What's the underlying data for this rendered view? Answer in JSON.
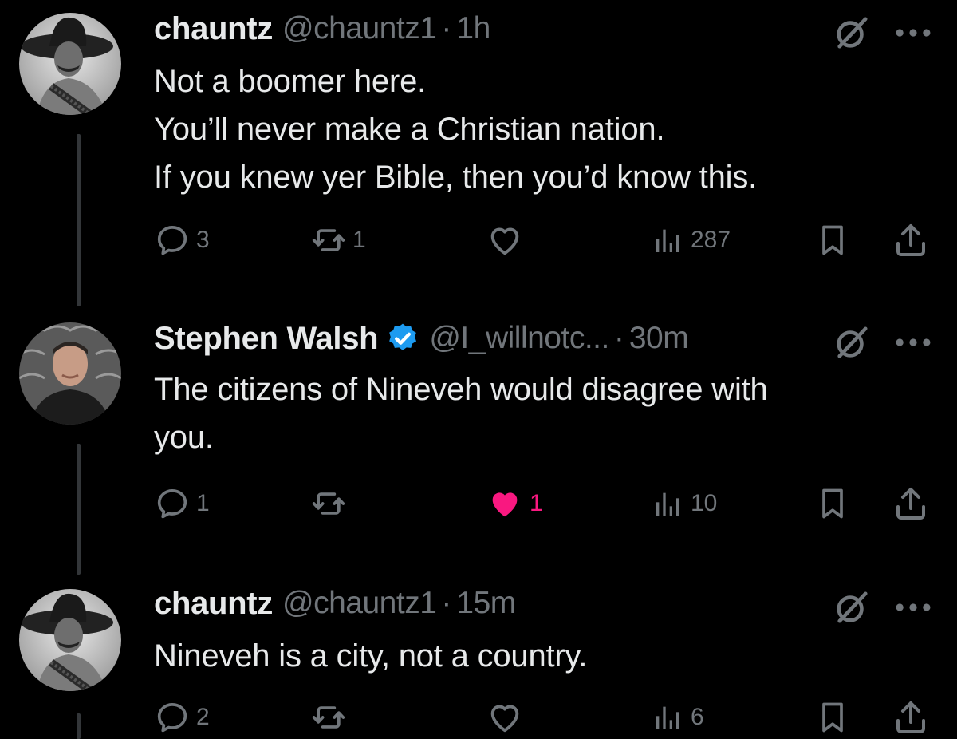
{
  "colors": {
    "background": "#000000",
    "text_primary": "#e7e9ea",
    "text_secondary": "#71767b",
    "like_active": "#f91880",
    "verified": "#1d9bf0"
  },
  "tweets": [
    {
      "display_name": "chauntz",
      "handle": "@chauntz1",
      "separator": "·",
      "time": "1h",
      "verified": false,
      "lines": [
        "Not a boomer here.",
        "You’ll never make a Christian nation.",
        "If you knew yer Bible, then you’d know this."
      ],
      "replies": "3",
      "reposts": "1",
      "likes": "",
      "views": "287",
      "liked": false,
      "avatar_icon": "avatar-sombrero-photo"
    },
    {
      "display_name": "Stephen Walsh",
      "handle": "@I_willnotc...",
      "separator": "·",
      "time": "30m",
      "verified": true,
      "lines": [
        "The citizens of Nineveh would disagree with",
        "you."
      ],
      "replies": "1",
      "reposts": "",
      "likes": "1",
      "views": "10",
      "liked": true,
      "avatar_icon": "avatar-man-photo"
    },
    {
      "display_name": "chauntz",
      "handle": "@chauntz1",
      "separator": "·",
      "time": "15m",
      "verified": false,
      "lines": [
        "Nineveh is a city, not a country."
      ],
      "replies": "2",
      "reposts": "",
      "likes": "",
      "views": "6",
      "liked": false,
      "avatar_icon": "avatar-sombrero-photo"
    }
  ],
  "icons": {
    "reply": "reply-icon",
    "repost": "repost-icon",
    "like": "heart-icon",
    "views": "views-icon",
    "bookmark": "bookmark-icon",
    "share": "share-icon",
    "grok": "grok-icon",
    "more": "more-icon",
    "verified": "verified-badge-icon"
  }
}
